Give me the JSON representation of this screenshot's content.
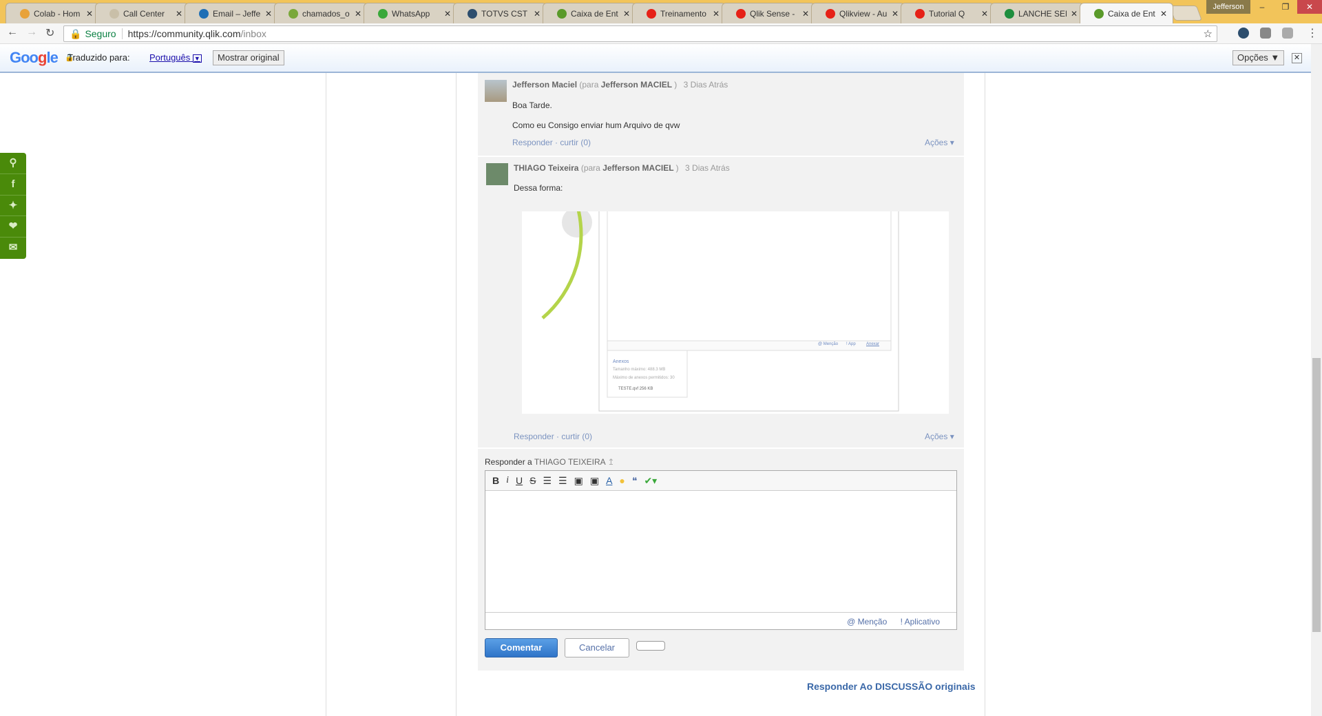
{
  "browser": {
    "tabs": [
      {
        "label": "Colab - Hom",
        "color": "#e8a23a"
      },
      {
        "label": "Call Center",
        "color": "#c9bfa8"
      },
      {
        "label": "Email – Jeffer",
        "color": "#1f6fb5"
      },
      {
        "label": "chamados_o",
        "color": "#7aa83a"
      },
      {
        "label": "WhatsApp",
        "color": "#3aa83a"
      },
      {
        "label": "TOTVS CST",
        "color": "#2d4e6e"
      },
      {
        "label": "Caixa de Ent",
        "color": "#5a9a2a"
      },
      {
        "label": "Treinamento",
        "color": "#e62117"
      },
      {
        "label": "Qlik Sense -",
        "color": "#e62117"
      },
      {
        "label": "Qlikview - Au",
        "color": "#e62117"
      },
      {
        "label": "Tutorial Q",
        "color": "#e62117"
      },
      {
        "label": "LANCHE SEN",
        "color": "#1e8e3e"
      },
      {
        "label": "Caixa de Ent",
        "color": "#5a9a2a",
        "active": true
      }
    ],
    "profile": "Jefferson",
    "security_label": "Seguro",
    "url_host": "https://community.qlik.com",
    "url_path": "/inbox"
  },
  "translate": {
    "logo": "Google",
    "label": "Traduzido para:",
    "language": "Português",
    "show_original": "Mostrar original",
    "options": "Opções ▼"
  },
  "social": [
    "qlik-icon",
    "facebook-icon",
    "twitter-icon",
    "heart-icon",
    "mail-icon"
  ],
  "comments": [
    {
      "author": "Jefferson Maciel",
      "to_prefix": "(para",
      "to": "Jefferson MACIEL",
      "to_suffix": ")",
      "time": "3 Dias Atrás",
      "lines": [
        "Boa Tarde.",
        "Como eu Consigo enviar hum Arquivo de qvw"
      ],
      "reply": "Responder",
      "like": "curtir (0)",
      "actions": "Ações"
    },
    {
      "author": "THIAGO Teixeira",
      "to_prefix": "(para",
      "to": "Jefferson MACIEL",
      "to_suffix": ")",
      "time": "3 Dias Atrás",
      "lines": [
        "Dessa forma:"
      ],
      "reply": "Responder",
      "like": "curtir (0)",
      "actions": "Ações"
    }
  ],
  "screenshot": {
    "mention": "@ Menção",
    "app": "! App",
    "attach": "Anexar",
    "attachments_title": "Anexos",
    "max_size": "Tamanho máximo: 488.3 MB",
    "max_count": "Máximo de anexos permitidos: 30",
    "file": "TESTE.qvf 256 KB"
  },
  "reply": {
    "prefix": "Responder a",
    "target": "THIAGO TEIXEIRA",
    "mention": "@ Menção",
    "app": "! Aplicativo",
    "submit": "Comentar",
    "cancel": "Cancelar",
    "original": "Responder Ao DISCUSSÃO originais"
  }
}
